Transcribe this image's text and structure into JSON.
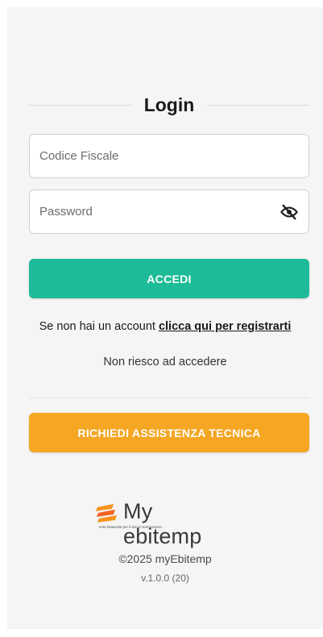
{
  "login": {
    "title": "Login",
    "codice_fiscale": {
      "placeholder": "Codice Fiscale",
      "value": ""
    },
    "password": {
      "placeholder": "Password",
      "value": ""
    },
    "password_toggle_icon": "eye-off-icon",
    "submit_label": "ACCEDI",
    "register_prefix": "Se non hai un account ",
    "register_link": "clicca qui per registrarti",
    "forgot_label": "Non riesco ad accedere"
  },
  "support": {
    "button_label": "RICHIEDI ASSISTENZA TECNICA"
  },
  "footer": {
    "brand": "My ebitemp",
    "tagline": "ente bilaterale per il lavoro temporaneo",
    "copyright": "©2025 myEbitemp",
    "version": "v.1.0.0 (20)"
  },
  "colors": {
    "primary": "#1dbb97",
    "assist": "#f5a623",
    "logo_orange": "#f7941d",
    "background": "#f5f5f5"
  }
}
